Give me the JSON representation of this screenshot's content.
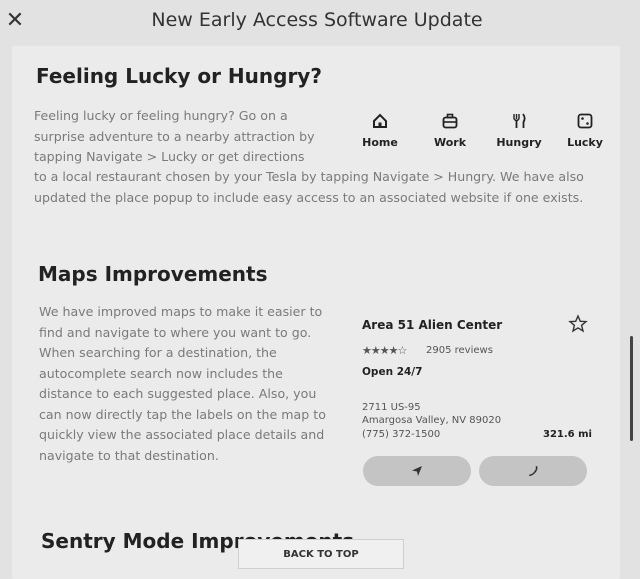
{
  "header": {
    "close_icon": "close-icon",
    "title": "New Early Access Software Update"
  },
  "lucky": {
    "heading": "Feeling Lucky or Hungry?",
    "text_a": "Feeling lucky or feeling hungry? Go on a surprise adventure to a nearby attraction by tapping Navigate > Lucky or get directions",
    "text_b": "to a local restaurant chosen by your Tesla by tapping Navigate > Hungry. We have also updated the place popup to include easy access to an associated website if one exists.",
    "shortcuts": [
      {
        "label": "Home",
        "icon": "home-icon"
      },
      {
        "label": "Work",
        "icon": "briefcase-icon"
      },
      {
        "label": "Hungry",
        "icon": "fork-knife-icon"
      },
      {
        "label": "Lucky",
        "icon": "dice-icon"
      }
    ]
  },
  "maps": {
    "heading": "Maps Improvements",
    "text": "We have improved maps to make it easier to find and navigate to where you want to go. When searching for a destination, the autocomplete search now includes the distance to each suggested place. Also, you can now directly tap the labels on the map to quickly view the associated place details and navigate to that destination.",
    "place": {
      "name": "Area 51 Alien Center",
      "stars": "★★★★☆",
      "rating": 4,
      "reviews": "2905 reviews",
      "hours": "Open 24/7",
      "address_line1": "2711 US-95",
      "address_line2": "Amargosa Valley, NV 89020",
      "phone": "(775) 372-1500",
      "distance": "321.6 mi"
    }
  },
  "sentry": {
    "heading": "Sentry Mode Improvements"
  },
  "back_to_top": "BACK TO TOP"
}
